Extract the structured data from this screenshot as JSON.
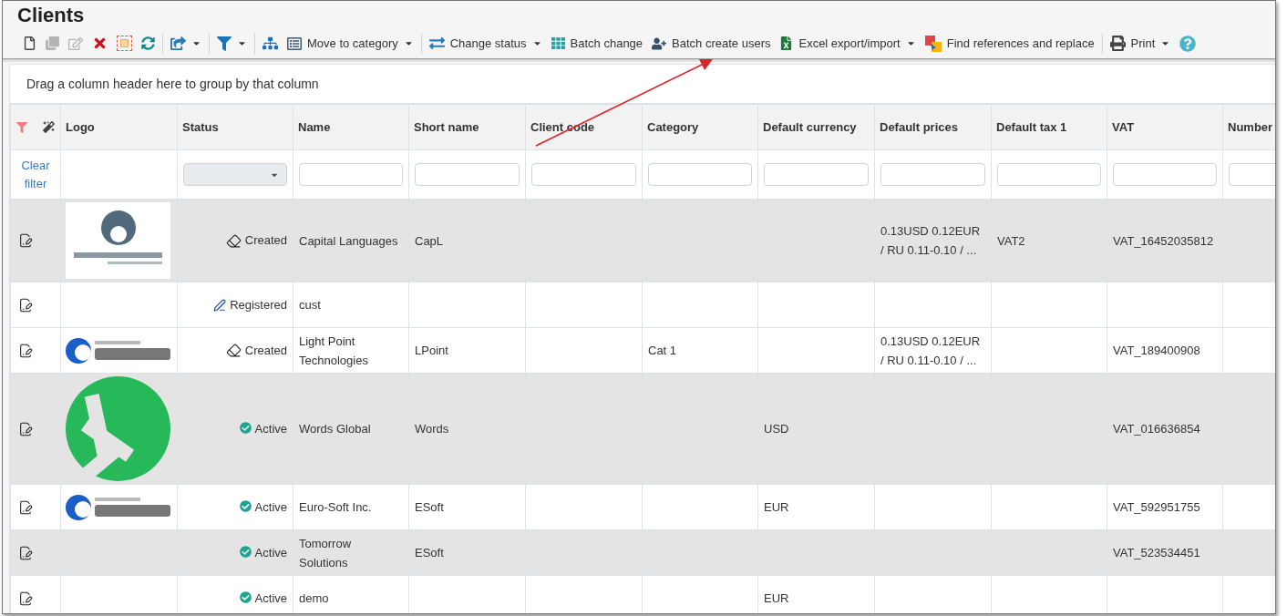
{
  "window": {
    "title": "Clients"
  },
  "toolbar": [
    {
      "dropdown": false,
      "disabled": false
    },
    {
      "dropdown": false,
      "disabled": true
    },
    {
      "dropdown": false,
      "disabled": true
    },
    {
      "dropdown": false,
      "disabled": false
    },
    {
      "dropdown": false,
      "disabled": false
    },
    {
      "dropdown": false,
      "disabled": false
    },
    {
      "dropdown": true,
      "disabled": false
    },
    {
      "dropdown": true,
      "disabled": false
    },
    {
      "dropdown": false,
      "disabled": false
    },
    {
      "label": "Move to category",
      "dropdown": true,
      "disabled": false
    },
    {
      "label": "Change status",
      "dropdown": true,
      "disabled": false
    },
    {
      "label": "Batch change",
      "dropdown": false,
      "disabled": false
    },
    {
      "label": "Batch create users",
      "dropdown": false,
      "disabled": false
    },
    {
      "label": "Excel export/import",
      "dropdown": true,
      "disabled": false
    },
    {
      "label": "Find references and replace",
      "dropdown": false,
      "disabled": false
    },
    {
      "label": "Print",
      "dropdown": true,
      "disabled": false
    },
    {
      "dropdown": false,
      "disabled": false
    }
  ],
  "group_panel": {
    "hint": "Drag a column header here to group by that column"
  },
  "table": {
    "columns": [
      "Logo",
      "Status",
      "Name",
      "Short name",
      "Client code",
      "Category",
      "Default currency",
      "Default prices",
      "Default tax 1",
      "VAT",
      "Number"
    ],
    "clear_filter": "Clear filter",
    "rows": [
      {
        "highlighted": true,
        "logo": {
          "kind": "circle"
        },
        "status": {
          "kind": "created",
          "label": "Created"
        },
        "name": "Capital Languages",
        "short_name": "CapL",
        "prices": "0.13USD 0.12EUR / RU 0.11-0.10 / ...",
        "tax": "VAT2",
        "vat": "VAT_16452035812"
      },
      {
        "highlighted": false,
        "status": {
          "kind": "registered",
          "label": "Registered"
        },
        "name": "cust"
      },
      {
        "highlighted": false,
        "logo": {
          "kind": "swirl"
        },
        "status": {
          "kind": "created",
          "label": "Created"
        },
        "name": "Light Point Technologies",
        "short_name": "LPoint",
        "category": "Cat 1",
        "prices": "0.13USD 0.12EUR / RU 0.11-0.10 / ...",
        "vat": "VAT_189400908"
      },
      {
        "highlighted": true,
        "logo": {
          "kind": "asterisk"
        },
        "status": {
          "kind": "active",
          "label": "Active"
        },
        "name": "Words Global",
        "short_name": "Words",
        "currency": "USD",
        "vat": "VAT_016636854"
      },
      {
        "highlighted": false,
        "logo": {
          "kind": "swirl"
        },
        "status": {
          "kind": "active",
          "label": "Active"
        },
        "name": "Euro-Soft Inc.",
        "short_name": "ESoft",
        "currency": "EUR",
        "vat": "VAT_592951755"
      },
      {
        "highlighted": true,
        "status": {
          "kind": "active",
          "label": "Active"
        },
        "name": "Tomorrow Solutions",
        "short_name": "ESoft",
        "vat": "VAT_523534451"
      },
      {
        "highlighted": false,
        "status": {
          "kind": "active",
          "label": "Active"
        },
        "name": "demo",
        "currency": "EUR"
      }
    ]
  }
}
